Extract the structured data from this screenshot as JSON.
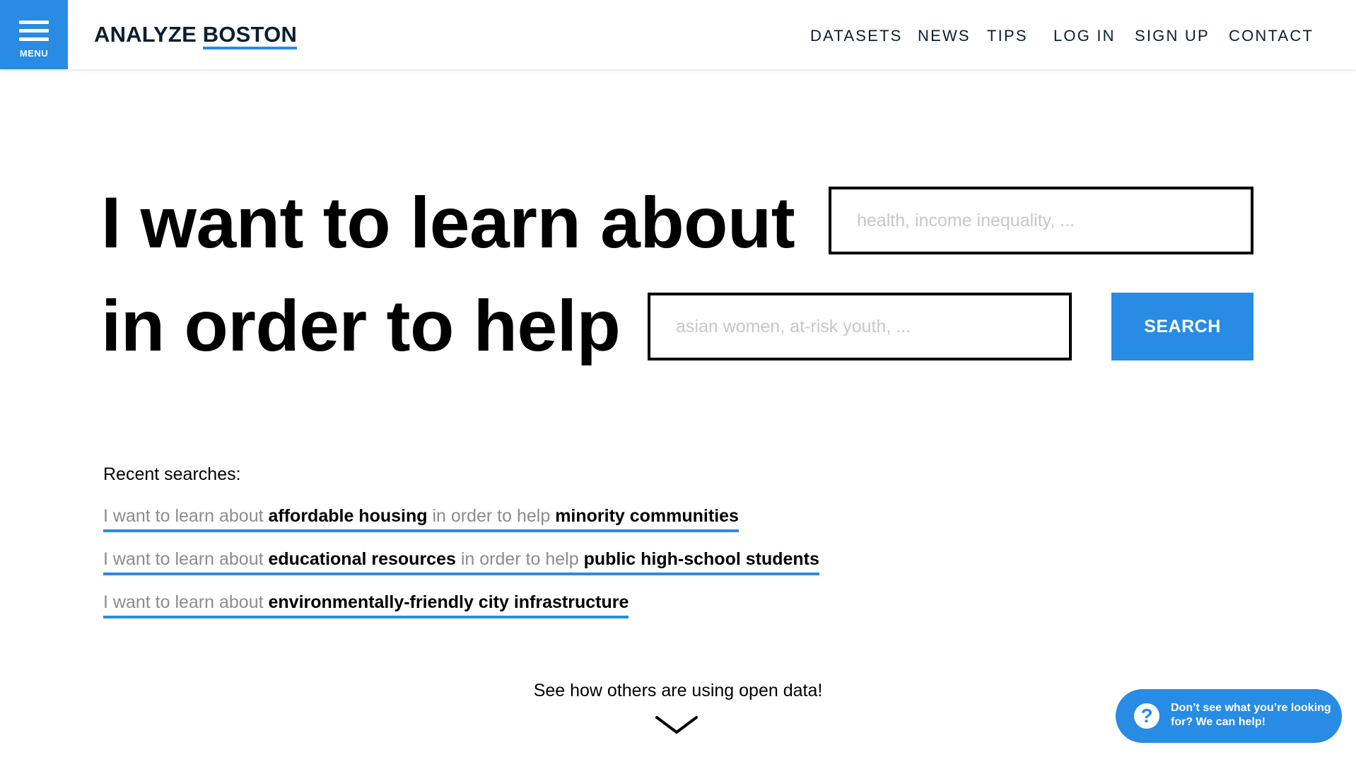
{
  "header": {
    "menu_label": "MENU",
    "brand_part1": "ANALYZE",
    "brand_part2": "BOSTON",
    "nav": [
      "DATASETS",
      "NEWS",
      "TIPS",
      "LOG IN",
      "SIGN UP",
      "CONTACT"
    ]
  },
  "hero": {
    "line1": "I want to learn about",
    "line2": "in order to help",
    "topic_placeholder": "health, income inequality, ...",
    "audience_placeholder": "asian women, at-risk youth, ...",
    "search_label": "SEARCH"
  },
  "recent": {
    "title": "Recent searches:",
    "items": [
      {
        "prefix": "I want to learn about",
        "topic": "affordable housing",
        "middle": "in order to help",
        "audience": "minority communities"
      },
      {
        "prefix": "I want to learn about",
        "topic": "educational resources",
        "middle": "in order to help",
        "audience": "public high-school students"
      },
      {
        "prefix": "I want to learn about",
        "topic": "environmentally-friendly city infrastructure"
      }
    ]
  },
  "footer": {
    "see_others": "See how others are using open data!",
    "help_text": "Don’t see what you’re looking for? We can help!",
    "help_icon": "?"
  },
  "colors": {
    "accent": "#288be4",
    "brand_text": "#091f2f",
    "muted_text": "#8c8c8c"
  },
  "icons": [
    "hamburger-icon",
    "chevron-down-icon",
    "question-icon"
  ]
}
